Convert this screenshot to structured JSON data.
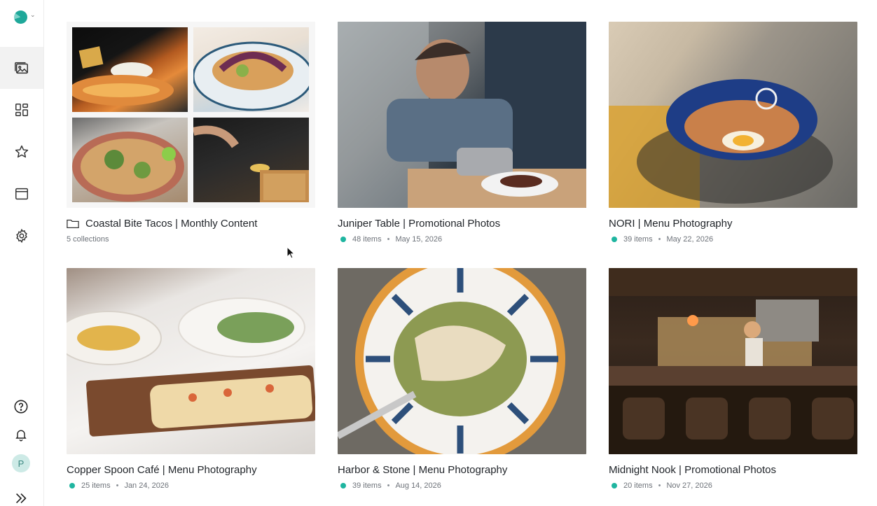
{
  "app": {
    "accent": "#1fb5a0"
  },
  "sidebar": {
    "logo": "brand-logo",
    "nav": [
      {
        "icon": "image-gallery-icon",
        "active": true
      },
      {
        "icon": "dashboard-grid-icon",
        "active": false
      },
      {
        "icon": "star-icon",
        "active": false
      },
      {
        "icon": "browser-window-icon",
        "active": false
      },
      {
        "icon": "gear-icon",
        "active": false
      }
    ],
    "bottom": {
      "help_icon": "help-circle-icon",
      "bell_icon": "bell-icon",
      "avatar_initial": "P",
      "expand_icon": "double-chevron-right-icon"
    }
  },
  "cards": [
    {
      "title": "Coastal Bite Tacos | Monthly Content",
      "count": "5 collections",
      "type": "folder"
    },
    {
      "title": "Juniper Table | Promotional Photos",
      "items": "48 items",
      "date": "May 15, 2026"
    },
    {
      "title": "NORI | Menu Photography",
      "items": "39 items",
      "date": "May 22, 2026"
    },
    {
      "title": "Copper Spoon Café | Menu Photography",
      "items": "25 items",
      "date": "Jan 24, 2026"
    },
    {
      "title": "Harbor & Stone | Menu Photography",
      "items": "39 items",
      "date": "Aug 14, 2026"
    },
    {
      "title": "Midnight Nook | Promotional Photos",
      "items": "20 items",
      "date": "Nov 27, 2026"
    }
  ],
  "separator": "•"
}
